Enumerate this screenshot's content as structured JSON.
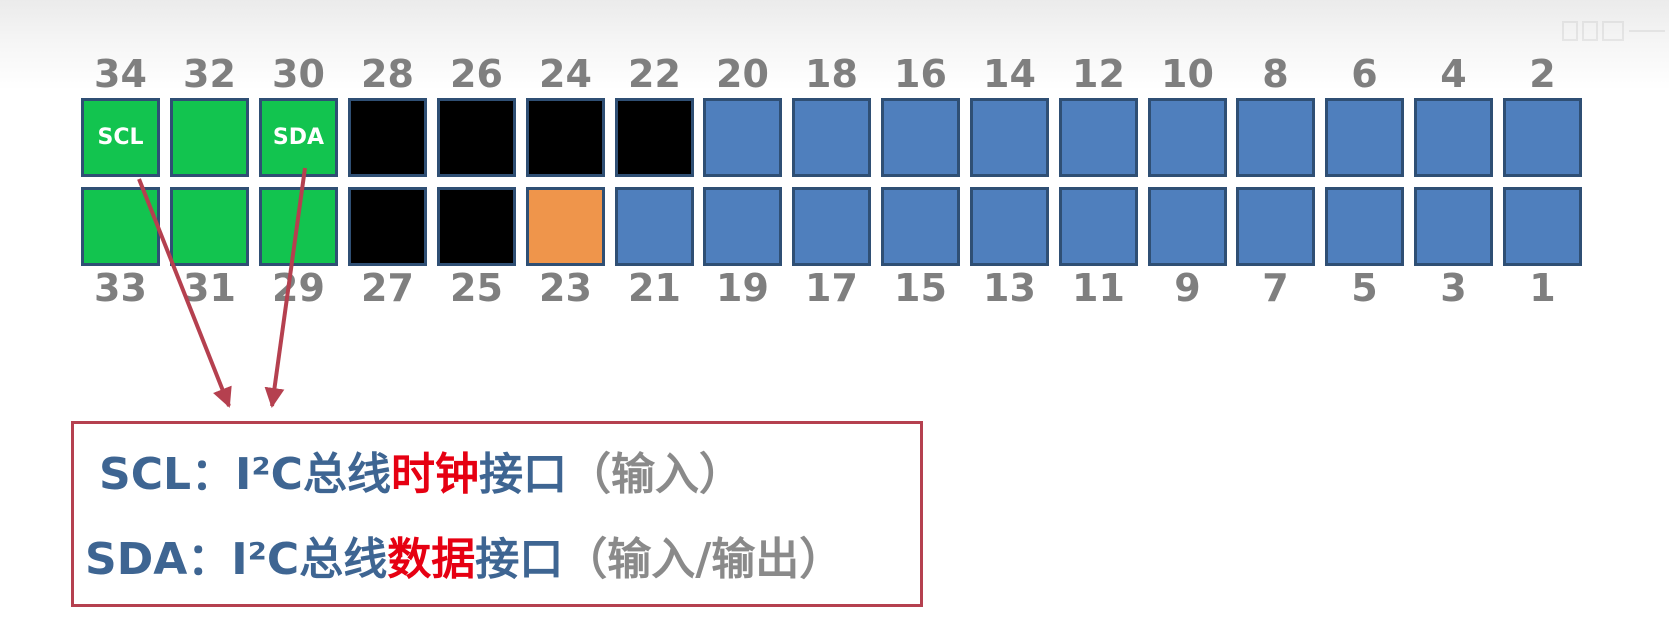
{
  "colors": {
    "green": "#12c44f",
    "black": "#000000",
    "blue": "#4f7fbd",
    "orange": "#ef954b",
    "pin_border": "#2f4f74",
    "number_gray": "#7f7f7f",
    "arrow": "#b5404f",
    "legend_text": "#3e6592",
    "legend_highlight": "#e60012"
  },
  "top_row": [
    {
      "number": "34",
      "color": "green",
      "label": "SCL"
    },
    {
      "number": "32",
      "color": "green",
      "label": ""
    },
    {
      "number": "30",
      "color": "green",
      "label": "SDA"
    },
    {
      "number": "28",
      "color": "black",
      "label": ""
    },
    {
      "number": "26",
      "color": "black",
      "label": ""
    },
    {
      "number": "24",
      "color": "black",
      "label": ""
    },
    {
      "number": "22",
      "color": "black",
      "label": ""
    },
    {
      "number": "20",
      "color": "blue",
      "label": ""
    },
    {
      "number": "18",
      "color": "blue",
      "label": ""
    },
    {
      "number": "16",
      "color": "blue",
      "label": ""
    },
    {
      "number": "14",
      "color": "blue",
      "label": ""
    },
    {
      "number": "12",
      "color": "blue",
      "label": ""
    },
    {
      "number": "10",
      "color": "blue",
      "label": ""
    },
    {
      "number": "8",
      "color": "blue",
      "label": ""
    },
    {
      "number": "6",
      "color": "blue",
      "label": ""
    },
    {
      "number": "4",
      "color": "blue",
      "label": ""
    },
    {
      "number": "2",
      "color": "blue",
      "label": ""
    }
  ],
  "bottom_row": [
    {
      "number": "33",
      "color": "green"
    },
    {
      "number": "31",
      "color": "green"
    },
    {
      "number": "29",
      "color": "green"
    },
    {
      "number": "27",
      "color": "black"
    },
    {
      "number": "25",
      "color": "black"
    },
    {
      "number": "23",
      "color": "orange"
    },
    {
      "number": "21",
      "color": "blue"
    },
    {
      "number": "19",
      "color": "blue"
    },
    {
      "number": "17",
      "color": "blue"
    },
    {
      "number": "15",
      "color": "blue"
    },
    {
      "number": "13",
      "color": "blue"
    },
    {
      "number": "11",
      "color": "blue"
    },
    {
      "number": "9",
      "color": "blue"
    },
    {
      "number": "7",
      "color": "blue"
    },
    {
      "number": "5",
      "color": "blue"
    },
    {
      "number": "3",
      "color": "blue"
    },
    {
      "number": "1",
      "color": "blue"
    }
  ],
  "legend": {
    "scl": {
      "name": "SCL",
      "sep": "：",
      "prefix": "I²C总线",
      "highlight": "时钟",
      "suffix": "接口",
      "paren": "（输入）"
    },
    "sda": {
      "name": "SDA",
      "sep": "：",
      "prefix": "I²C总线",
      "highlight": "数据",
      "suffix": "接口",
      "paren": "（输入/输出）"
    }
  },
  "watermark_icon": "logo-watermark"
}
